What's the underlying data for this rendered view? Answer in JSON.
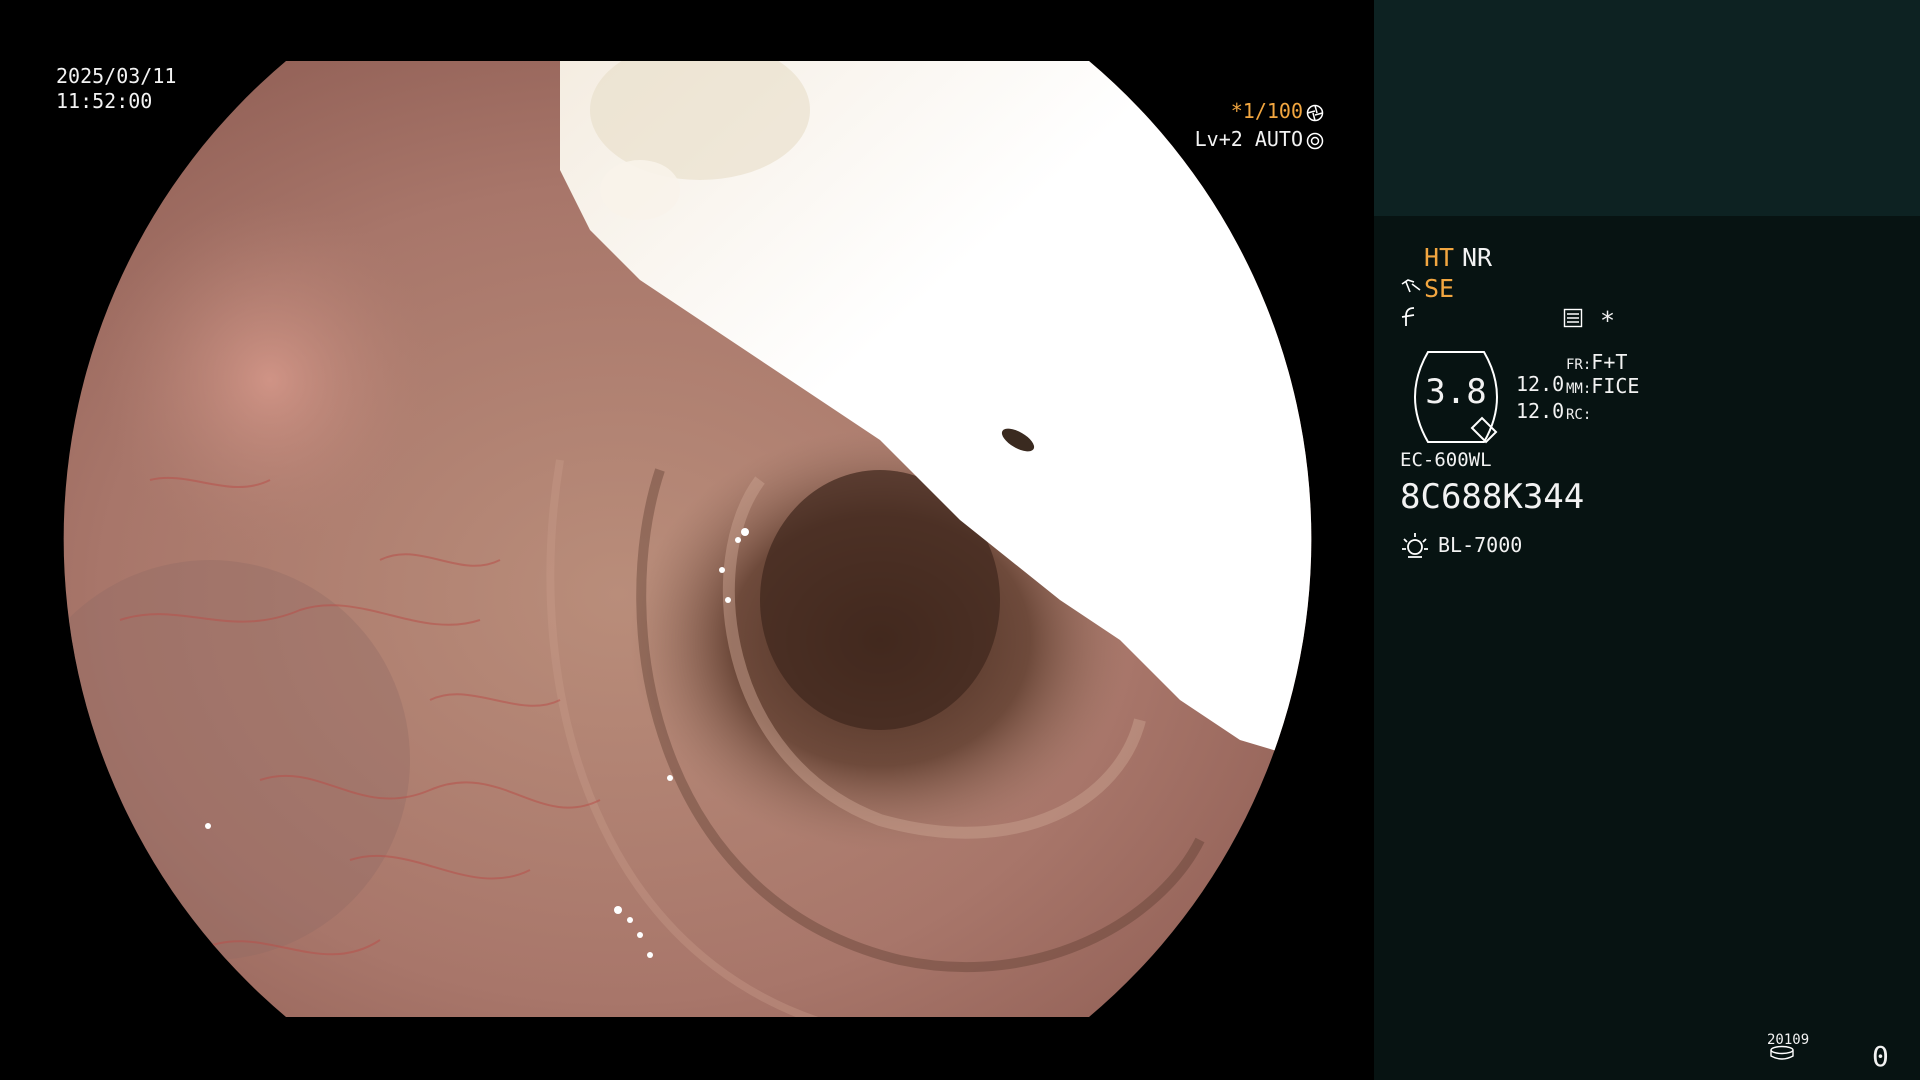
{
  "overlay": {
    "date": "2025/03/11",
    "time": "11:52:00",
    "shutter": "*1/100",
    "level": "Lv+2",
    "mode": "AUTO"
  },
  "panel": {
    "ht": "HT",
    "nr": "NR",
    "se": "SE",
    "star": "*",
    "lens_value": "3.8",
    "val1": "12.0",
    "val2": "12.0",
    "fr_label": "FR:",
    "fr_value": "F+T",
    "mm_label": "MM:",
    "mm_value": "FICE",
    "rc_label": "RC:",
    "scope_model": "EC-600WL",
    "serial": "8C688K344",
    "light_source": "BL-7000",
    "counter_label": "20109",
    "counter_value": "0"
  },
  "colors": {
    "accent_orange": "#f2a640",
    "panel_bg": "#071312",
    "panel_top_bg": "#0d2222",
    "text": "#f2f2f2"
  },
  "icons": [
    "aperture-icon",
    "auto-iris-icon",
    "structure-enhance-icon",
    "freeze-icon",
    "memo-icon",
    "lens-icon",
    "lamp-icon",
    "counter-icon"
  ]
}
